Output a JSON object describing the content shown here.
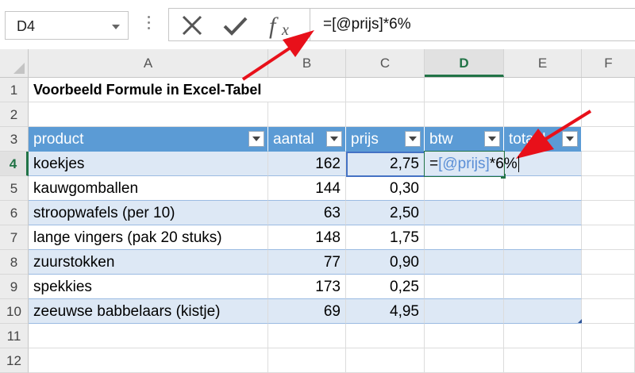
{
  "name_box": {
    "value": "D4"
  },
  "formula_bar": {
    "value": "=[@prijs]*6%"
  },
  "columns": [
    "A",
    "B",
    "C",
    "D",
    "E",
    "F"
  ],
  "rows": [
    "1",
    "2",
    "3",
    "4",
    "5",
    "6",
    "7",
    "8",
    "9",
    "10",
    "11",
    "12"
  ],
  "title": "Voorbeeld Formule in Excel-Tabel",
  "table": {
    "headers": [
      "product",
      "aantal",
      "prijs",
      "btw",
      "totaal"
    ],
    "rows": [
      {
        "product": "koekjes",
        "aantal": "162",
        "prijs": "2,75"
      },
      {
        "product": "kauwgomballen",
        "aantal": "144",
        "prijs": "0,30"
      },
      {
        "product": "stroopwafels (per 10)",
        "aantal": "63",
        "prijs": "2,50"
      },
      {
        "product": "lange vingers (pak 20 stuks)",
        "aantal": "148",
        "prijs": "1,75"
      },
      {
        "product": "zuurstokken",
        "aantal": "77",
        "prijs": "0,90"
      },
      {
        "product": "spekkies",
        "aantal": "173",
        "prijs": "0,25"
      },
      {
        "product": "zeeuwse babbelaars (kistje)",
        "aantal": "69",
        "prijs": "4,95"
      }
    ]
  },
  "editing_cell": {
    "equals": "=",
    "ref": "[@prijs]",
    "suffix": "*6%"
  },
  "colors": {
    "header_blue": "#5b9bd5",
    "band_blue": "#dde8f5",
    "selection_green": "#217346",
    "arrow_red": "#e8101a",
    "reference_blue": "#4472c4"
  }
}
